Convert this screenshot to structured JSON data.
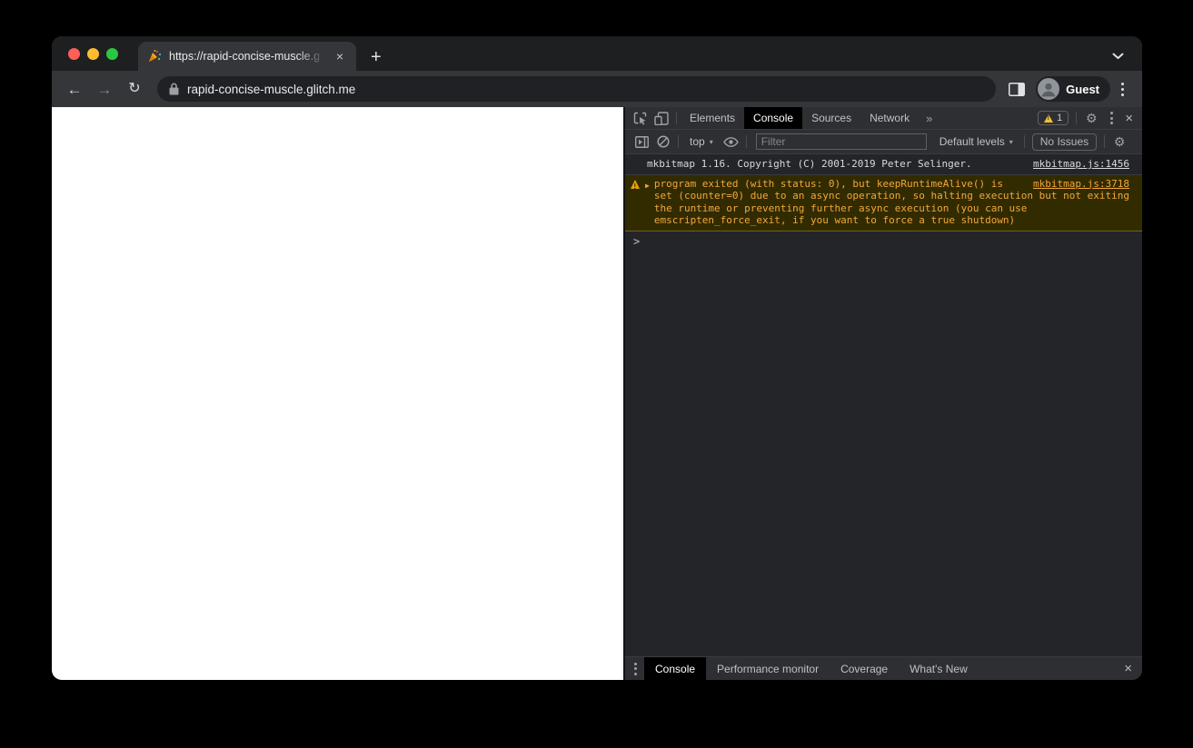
{
  "browser": {
    "tab": {
      "title": "https://rapid-concise-muscle.g",
      "favicon": "party-popper"
    },
    "url": "rapid-concise-muscle.glitch.me",
    "profile_label": "Guest"
  },
  "icons": {
    "back": "←",
    "forward": "→",
    "reload": "↻",
    "new_tab": "+",
    "close_tab": "✕",
    "close": "×",
    "more_tabs": "»",
    "dropdown": "▾",
    "gear": "⚙",
    "expand_arrow": "▶"
  },
  "devtools": {
    "tabs": [
      "Elements",
      "Console",
      "Sources",
      "Network"
    ],
    "active_tab": "Console",
    "warning_count": "1",
    "toolbar": {
      "context": "top",
      "filter_placeholder": "Filter",
      "levels_label": "Default levels",
      "issues_label": "No Issues"
    },
    "console": {
      "messages": [
        {
          "type": "log",
          "text": "mkbitmap 1.16. Copyright (C) 2001-2019 Peter Selinger.",
          "source": "mkbitmap.js:1456"
        },
        {
          "type": "warning",
          "text": "program exited (with status: 0), but keepRuntimeAlive() is set (counter=0) due to an async operation, so halting execution but not exiting the runtime or preventing further async execution (you can use emscripten_force_exit, if you want to force a true shutdown)",
          "source": "mkbitmap.js:3718"
        }
      ],
      "prompt": ">"
    },
    "drawer": {
      "tabs": [
        "Console",
        "Performance monitor",
        "Coverage",
        "What's New"
      ],
      "active": "Console"
    }
  },
  "colors": {
    "traffic_red": "#ff5f57",
    "traffic_yellow": "#febc2e",
    "traffic_green": "#28c840",
    "warning_bg": "#332b00",
    "warning_text": "#f0a73c",
    "warning_badge_triangle": "#f2c12e",
    "devtools_active_tab_bg": "#000000",
    "page_bg": "#ffffff"
  }
}
